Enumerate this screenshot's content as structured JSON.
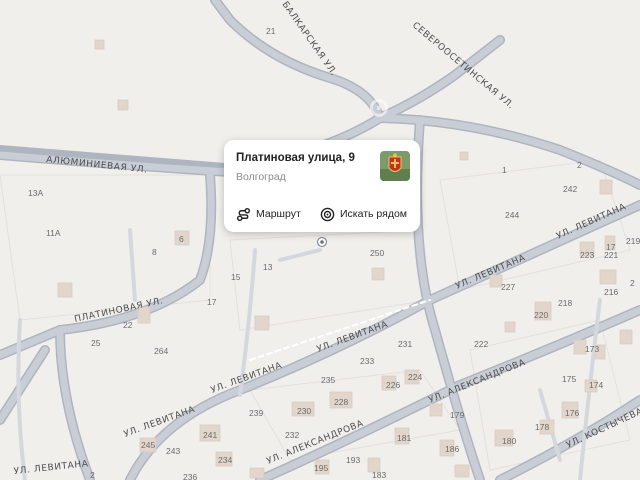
{
  "popup": {
    "title": "Платиновая улица, 9",
    "subtitle": "Волгоград",
    "route_label": "Маршрут",
    "nearby_label": "Искать рядом"
  },
  "streets": {
    "aluminievaya": "АЛЮМИНИЕВАЯ УЛ.",
    "platinovaya": "ПЛАТИНОВАЯ УЛ.",
    "levitana_1": "УЛ. ЛЕВИТАНА",
    "levitana_2": "УЛ. ЛЕВИТАНА",
    "levitana_3": "УЛ. ЛЕВИТАНА",
    "levitana_4": "УЛ. ЛЕВИТАНА",
    "levitana_5": "УЛ. ЛЕВИТАНА",
    "levitana_6": "УЛ. ЛЕВИТАНА",
    "aleksandrova_1": "УЛ. АЛЕКСАНДРОВА",
    "aleksandrova_2": "УЛ. АЛЕКСАНДРОВА",
    "kostycheva": "УЛ. КОСТЫЧЕВА",
    "severoosetinskaya": "СЕВЕРООСЕТИНСКАЯ УЛ.",
    "balkarskaya": "БАЛКАРСКАЯ УЛ."
  },
  "houses": [
    "21",
    "13А",
    "11А",
    "8",
    "6",
    "1",
    "2",
    "242",
    "244",
    "250",
    "223",
    "221",
    "219",
    "216",
    "15",
    "13",
    "17",
    "22",
    "227",
    "220",
    "218",
    "2",
    "25",
    "264",
    "231",
    "222",
    "173",
    "233",
    "235",
    "226",
    "224",
    "175",
    "174",
    "239",
    "230",
    "228",
    "179",
    "176",
    "232",
    "241",
    "245",
    "243",
    "181",
    "186",
    "180",
    "178",
    "236",
    "234",
    "195",
    "193",
    "183",
    "17",
    "2"
  ],
  "colors": {
    "background": "#f1efec",
    "road": "#c9ced6",
    "road_edge": "#aeb5c0",
    "building": "#e2d6cc",
    "building_outline": "#d8ccc1"
  },
  "icons": {
    "route": "route-icon",
    "nearby": "search-nearby-icon",
    "pin": "location-pin-icon",
    "thumb": "coat-of-arms-icon"
  }
}
